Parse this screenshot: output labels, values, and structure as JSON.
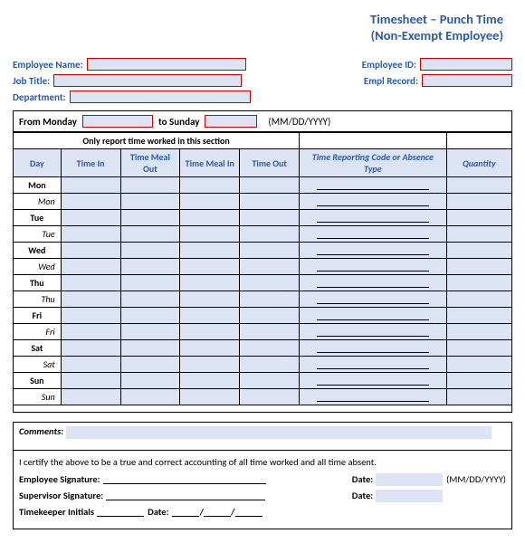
{
  "title": {
    "line1": "Timesheet – Punch Time",
    "line2": "(Non-Exempt Employee)"
  },
  "header": {
    "employee_name_label": "Employee Name:",
    "employee_id_label": "Employee ID:",
    "job_title_label": "Job Title:",
    "empl_record_label": "Empl Record:",
    "department_label": "Department:"
  },
  "date_range": {
    "from_label": "From Monday",
    "to_label": "to Sunday",
    "format": "(MM/DD/YYYY)"
  },
  "sheet": {
    "section_left": "Only report time worked in this section",
    "cols": {
      "day": "Day",
      "time_in": "Time In",
      "meal_out": "Time Meal Out",
      "meal_in": "Time Meal In",
      "time_out": "Time Out",
      "code": "Time Reporting Code or Absence Type",
      "qty": "Quantity"
    },
    "days": [
      "Mon",
      "Tue",
      "Wed",
      "Thu",
      "Fri",
      "Sat",
      "Sun"
    ]
  },
  "comments_label": "Comments:",
  "cert": {
    "statement": "I certify the above to be a true and correct accounting of all time worked and all time absent.",
    "emp_sig": "Employee Signature:",
    "date_label": "Date:",
    "date_fmt": "(MM/DD/YYYY)",
    "sup_sig": "Supervisor Signature:",
    "tk_label": "Timekeeper Initials"
  }
}
